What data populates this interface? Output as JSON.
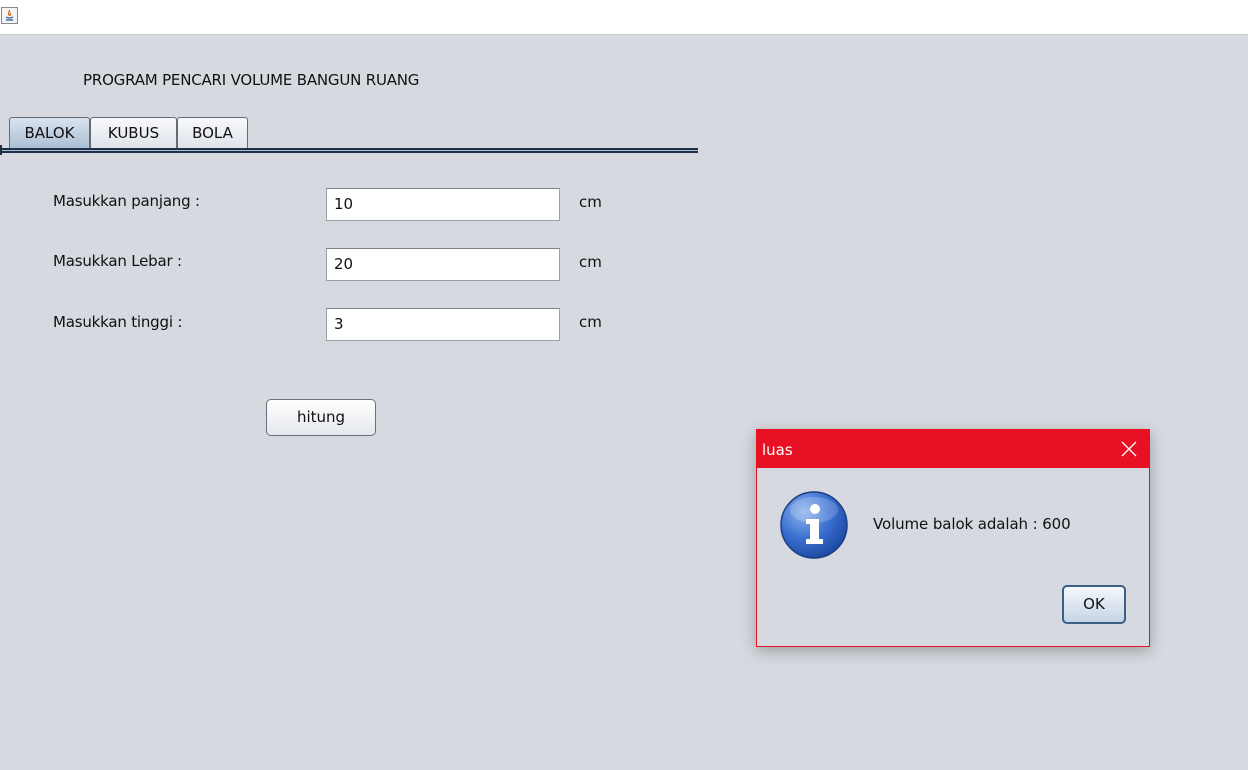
{
  "window": {
    "icon": "java-app-icon"
  },
  "main": {
    "heading": "PROGRAM PENCARI VOLUME BANGUN RUANG",
    "tabs": [
      {
        "label": "BALOK",
        "active": true
      },
      {
        "label": "KUBUS",
        "active": false
      },
      {
        "label": "BOLA",
        "active": false
      }
    ],
    "form": {
      "panjang_label": "Masukkan panjang :",
      "panjang_value": "10",
      "lebar_label": "Masukkan Lebar :",
      "lebar_value": "20",
      "tinggi_label": "Masukkan tinggi :",
      "tinggi_value": "3",
      "unit": "cm"
    },
    "hitung_button": "hitung"
  },
  "dialog": {
    "title": "luas",
    "icon": "info-icon",
    "message": "Volume balok adalah : 600",
    "ok_label": "OK",
    "accent_color": "#e81123"
  }
}
